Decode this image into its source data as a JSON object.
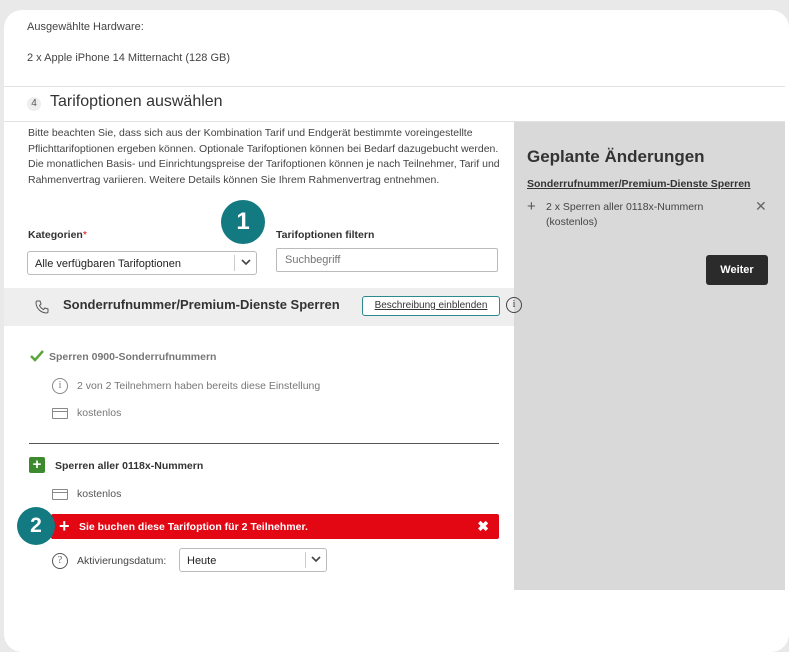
{
  "hardware": {
    "label": "Ausgewählte Hardware:",
    "value": "2 x Apple iPhone 14 Mitternacht (128 GB)"
  },
  "step": {
    "number": "4",
    "title": "Tarifoptionen auswählen"
  },
  "description": "Bitte beachten Sie, dass sich aus der Kombination Tarif und Endgerät bestimmte voreingestellte Pflichttarifoptionen ergeben können. Optionale Tarifoptionen können bei Bedarf dazugebucht werden. Die monatlichen Basis- und Einrichtungspreise der Tarifoptionen können je nach Teilnehmer, Tarif und Rahmenvertrag variieren. Weitere Details können Sie Ihrem Rahmenvertrag entnehmen.",
  "categories": {
    "label": "Kategorien",
    "required_mark": "*",
    "selected": "Alle verfügbaren Tarifoptionen"
  },
  "filter": {
    "label": "Tarifoptionen filtern",
    "placeholder": "Suchbegriff"
  },
  "group": {
    "title": "Sonderrufnummer/Premium-Dienste Sperren",
    "description_button": "Beschreibung einblenden",
    "info_glyph": "i"
  },
  "option1": {
    "title": "Sperren 0900-Sonderrufnummern",
    "info_glyph": "i",
    "info_text": "2 von 2 Teilnehmern haben bereits diese Einstellung",
    "price": "kostenlos"
  },
  "option2": {
    "title": "Sperren aller 0118x-Nummern",
    "price": "kostenlos",
    "booking_message": "Sie buchen diese Tarifoption für 2 Teilnehmer.",
    "help_glyph": "?",
    "activation_label": "Aktivierungsdatum:",
    "activation_value": "Heute"
  },
  "badges": {
    "one": "1",
    "two": "2"
  },
  "planned_changes": {
    "title": "Geplante Änderungen",
    "group": "Sonderrufnummer/Premium-Dienste Sperren",
    "item_line1": "2 x Sperren aller 0118x-Nummern",
    "item_line2": "(kostenlos)",
    "next_button": "Weiter"
  },
  "colors": {
    "accent_teal": "#137a82",
    "booking_red": "#e30613",
    "success_green": "#5aa63c",
    "add_green": "#3d8a2e",
    "panel_gray": "#d9d9d9"
  }
}
